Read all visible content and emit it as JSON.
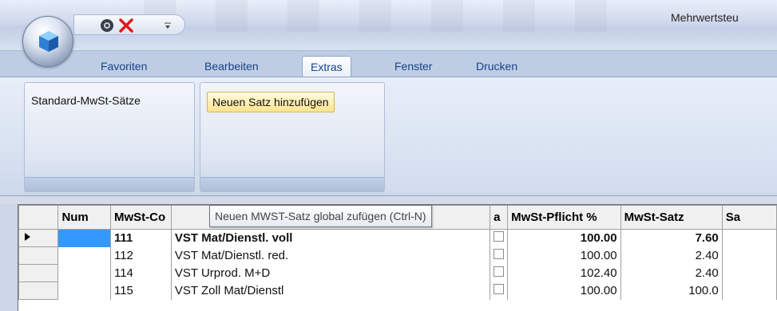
{
  "window": {
    "title": "Mehrwertsteu"
  },
  "quick_access": {
    "icons": [
      "help-icon",
      "close-icon",
      "dropdown-icon"
    ]
  },
  "tabs": [
    {
      "label": "Favoriten"
    },
    {
      "label": "Bearbeiten"
    },
    {
      "label": "Extras",
      "active": true
    },
    {
      "label": "Fenster"
    },
    {
      "label": "Drucken"
    }
  ],
  "ribbon": {
    "group1_label": "Standard-MwSt-Sätze",
    "add_button_label": "Neuen Satz hinzufügen"
  },
  "tooltip": {
    "text": "Neuen MWST-Satz global zufügen (Ctrl-N)"
  },
  "grid": {
    "headers": {
      "num": "Num",
      "code": "MwSt-Co",
      "desc": "",
      "flag": "a",
      "pflicht": "MwSt-Pflicht %",
      "satz": "MwSt-Satz",
      "sa": "Sa"
    },
    "rows": [
      {
        "num": "",
        "code": "111",
        "desc": "VST Mat/Dienstl. voll",
        "pflicht": "100.00",
        "satz": "7.60"
      },
      {
        "num": "",
        "code": "112",
        "desc": "VST Mat/Dienstl. red.",
        "pflicht": "100.00",
        "satz": "2.40"
      },
      {
        "num": "",
        "code": "114",
        "desc": "VST Urprod. M+D",
        "pflicht": "102.40",
        "satz": "2.40"
      },
      {
        "num": "",
        "code": "115",
        "desc": "VST Zoll Mat/Dienstl",
        "pflicht": "100.00",
        "satz": "100.0"
      }
    ]
  }
}
